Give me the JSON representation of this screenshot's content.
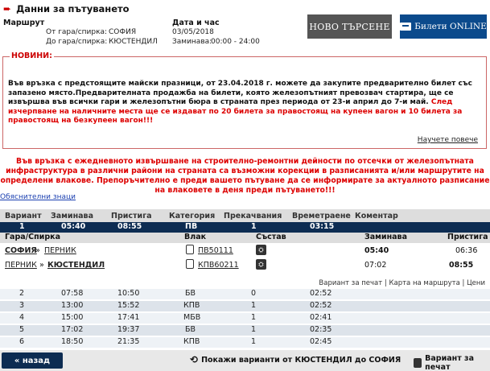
{
  "header": {
    "title": "Данни за пътуването",
    "route_label": "Маршрут",
    "from_label": "От гара/спирка:",
    "from_value": "СОФИЯ",
    "to_label": "До гара/спирка:",
    "to_value": "КЮСТЕНДИЛ",
    "datetime_label": "Дата и час",
    "date_value": "03/05/2018",
    "depart_label": "Заминава:",
    "depart_value": "00:00 - 24:00",
    "new_search_btn": "НОВО ТЪРСЕНЕ",
    "online_btn": "Билети ONLINE"
  },
  "news": {
    "legend": "НОВИНИ:",
    "text": "Във връзка с предстоящите майски празници, от 23.04.2018 г. можете да закупите предварително билет със запазено място.Предварителната продажба на билети, която железопътният превозвач стартира, ще се извършва във всички гари и железопътни бюра в страната през периода от 23-и април до 7-и май.",
    "text_red": "След изчерпване на наличните места ще се издават по 20 билета за правостоящ на купеен вагон и 10 билета за правостоящ на безкупеен вагон!!!",
    "more_link": "Научете повече"
  },
  "warning": "Във връзка с ежедневното извършване на строително-ремонтни дейности по отсечки от железопътната инфраструктура в различни райони на страната са възможни корекции в разписанията и/или маршрутите на определени влакове. Препоръчително е преди вашето пътуване да се информирате за актуалното разписание на влаковете в деня преди пътуването!!!",
  "legend_link": "Обяснителни знаци",
  "table": {
    "headers": [
      "Вариант",
      "Заминава",
      "Пристига",
      "Категория",
      "Прекачвания",
      "Времетраене",
      "Коментар"
    ],
    "selected": {
      "variant": "1",
      "depart": "05:40",
      "arrive": "08:55",
      "category": "ПВ",
      "transfers": "1",
      "duration": "03:15"
    },
    "rows": [
      {
        "variant": "2",
        "depart": "07:58",
        "arrive": "10:50",
        "category": "БВ",
        "transfers": "0",
        "duration": "02:52"
      },
      {
        "variant": "3",
        "depart": "13:00",
        "arrive": "15:52",
        "category": "КПВ",
        "transfers": "1",
        "duration": "02:52"
      },
      {
        "variant": "4",
        "depart": "15:00",
        "arrive": "17:41",
        "category": "МБВ",
        "transfers": "1",
        "duration": "02:41"
      },
      {
        "variant": "5",
        "depart": "17:02",
        "arrive": "19:37",
        "category": "БВ",
        "transfers": "1",
        "duration": "02:35"
      },
      {
        "variant": "6",
        "depart": "18:50",
        "arrive": "21:35",
        "category": "КПВ",
        "transfers": "1",
        "duration": "02:45"
      }
    ]
  },
  "detail": {
    "headers": [
      "Гара/Спирка",
      "Влак",
      "Състав",
      "Заминава",
      "Пристига"
    ],
    "lines": [
      {
        "from": "СОФИЯ",
        "sep": "»",
        "to": "ПЕРНИК",
        "train": "ПВ50111",
        "depart": "05:40",
        "arrive": "06:36"
      },
      {
        "from": "ПЕРНИК",
        "sep": "»",
        "to": "КЮСТЕНДИЛ",
        "train": "КПВ60211",
        "depart": "07:02",
        "arrive": "08:55"
      }
    ],
    "links": "Вариант за печат | Карта на маршрута | Цени"
  },
  "footer": {
    "back": "« назад",
    "reverse": "Покажи варианти от КЮСТЕНДИЛ до СОФИЯ",
    "print": "Вариант за печат"
  },
  "colors": {
    "accent_dark": "#0d2c52",
    "red": "#d00000",
    "online_blue": "#0b4a8c"
  }
}
